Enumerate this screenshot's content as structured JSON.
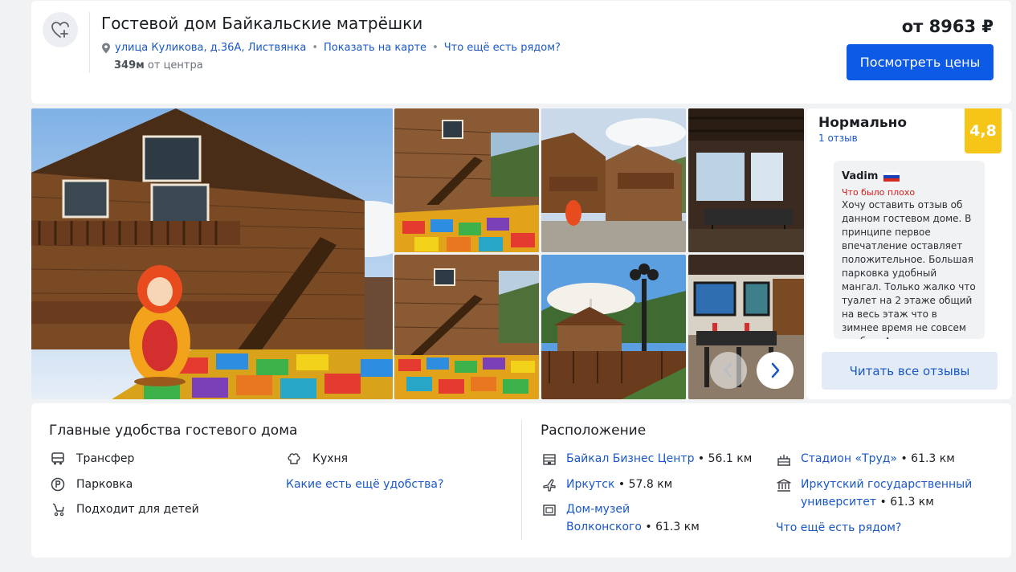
{
  "hotel": {
    "title": "Гостевой дом Байкальские матрёшки",
    "address": "улица Куликова, д.36А, Листвянка",
    "show_on_map": "Показать на карте",
    "nearby": "Что ещё есть рядом?",
    "distance_value": "349м",
    "distance_label": "от центра",
    "price": "от 8963 ₽",
    "price_button": "Посмотреть цены"
  },
  "reviews": {
    "rating_word": "Нормально",
    "count": "1 отзыв",
    "score": "4,8",
    "author": "Vadim",
    "bad_label": "Что было плохо",
    "text": "Хочу оставить отзыв об данном гостевом доме. В принципе первое впечатление оставляет положительное. Большая парковка удобный мангал. Только жалко что туалет на 2 этаже общий на весь этаж что в зимнее время не совсем удобно. А",
    "all_button": "Читать все отзывы"
  },
  "amenities": {
    "title": "Главные удобства гостевого дома",
    "items": [
      "Трансфер",
      "Парковка",
      "Подходит для детей",
      "Кухня"
    ],
    "more_link": "Какие есть ещё удобства?"
  },
  "location": {
    "title": "Расположение",
    "places": [
      {
        "name": "Байкал Бизнес Центр",
        "dist": "56.1 км",
        "icon": "business-center-icon"
      },
      {
        "name": "Иркутск",
        "dist": "57.8 км",
        "icon": "airplane-icon"
      },
      {
        "name_line1": "Дом-музей",
        "name_line2": "Волконского",
        "dist": "61.3 км",
        "icon": "museum-icon"
      },
      {
        "name": "Стадион «Труд»",
        "dist": "61.3 км",
        "icon": "stadium-icon"
      },
      {
        "name_line1": "Иркутский государственный",
        "name_line2": "университет",
        "dist": "61.3 км",
        "icon": "university-icon"
      }
    ],
    "nearby_link": "Что ещё есть рядом?"
  },
  "colors": {
    "primary": "#0c5ae5",
    "link": "#1a58c7",
    "score": "#f5c518",
    "bad": "#d41b1b"
  }
}
